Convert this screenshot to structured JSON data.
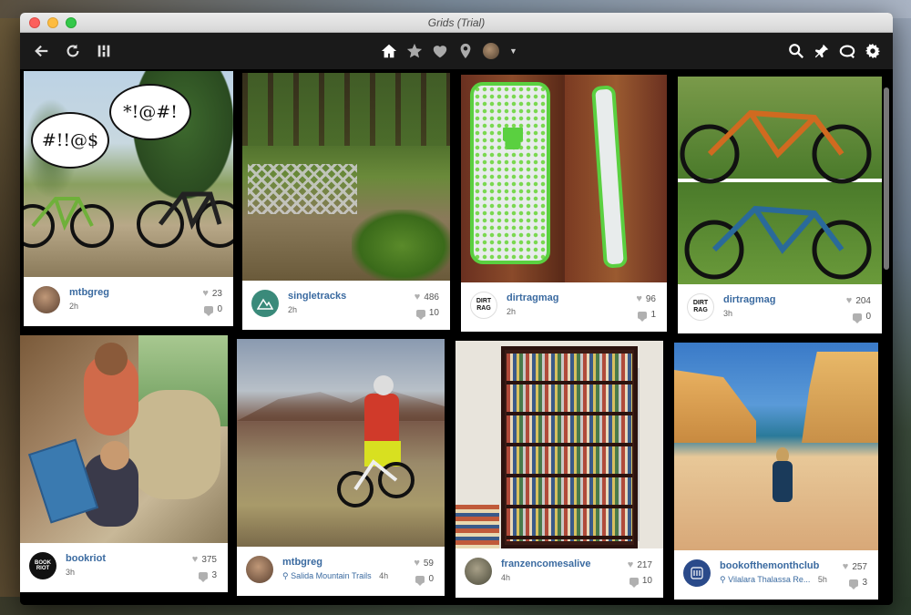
{
  "window": {
    "title": "Grids (Trial)"
  },
  "toolbar": {
    "left_icons": [
      "back-arrow-icon",
      "refresh-icon",
      "columns-icon"
    ],
    "center_icons": [
      "home-icon",
      "star-icon",
      "heart-icon",
      "location-pin-icon",
      "account-avatar"
    ],
    "right_icons": [
      "search-icon",
      "pin-icon",
      "tag-icon",
      "gear-icon"
    ]
  },
  "posts": [
    {
      "user": "mtbgreg",
      "time": "2h",
      "likes": "23",
      "comments": "0",
      "bubble1": "#!!@$",
      "bubble2": "*!@#!"
    },
    {
      "user": "singletracks",
      "time": "2h",
      "likes": "486",
      "comments": "10"
    },
    {
      "user": "dirtragmag",
      "time": "2h",
      "likes": "96",
      "comments": "1",
      "avatar_text": "DIRT RAG"
    },
    {
      "user": "dirtragmag",
      "time": "3h",
      "likes": "204",
      "comments": "0",
      "avatar_text": "DIRT RAG"
    },
    {
      "user": "bookriot",
      "time": "3h",
      "likes": "375",
      "comments": "3",
      "avatar_text": "BOOK RIOT"
    },
    {
      "user": "mtbgreg",
      "location": "Salida Mountain Trails",
      "time": "4h",
      "likes": "59",
      "comments": "0"
    },
    {
      "user": "franzencomesalive",
      "time": "4h",
      "likes": "217",
      "comments": "10"
    },
    {
      "user": "bookofthemonthclub",
      "location": "Vilalara Thalassa Re...",
      "time": "5h",
      "likes": "257",
      "comments": "3"
    }
  ]
}
